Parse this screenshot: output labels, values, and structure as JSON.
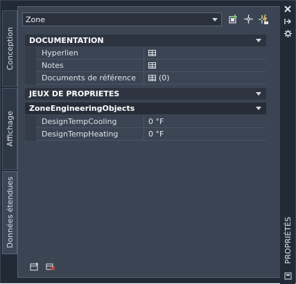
{
  "tabs": [
    {
      "label": "Conception"
    },
    {
      "label": "Affichage"
    },
    {
      "label": "Données étendues"
    }
  ],
  "selector": {
    "value": "Zone"
  },
  "toolbar": {
    "icons": [
      "select-objects-icon",
      "pick-point-icon",
      "quick-select-icon"
    ]
  },
  "sections": {
    "documentation": {
      "title": "DOCUMENTATION",
      "rows": [
        {
          "label": "Hyperlien",
          "value": ""
        },
        {
          "label": "Notes",
          "value": ""
        },
        {
          "label": "Documents de référence",
          "value": "(0)"
        }
      ]
    },
    "property_sets": {
      "title": "JEUX DE PROPRIETES",
      "subsection": {
        "title": "ZoneEngineeringObjects",
        "rows": [
          {
            "label": "DesignTempCooling",
            "value": "0 °F"
          },
          {
            "label": "DesignTempHeating",
            "value": "0 °F"
          }
        ]
      }
    }
  },
  "side": {
    "title": "PROPRIÉTÉS",
    "icons": [
      "close-icon",
      "auto-hide-icon",
      "settings-icon",
      "properties-icon"
    ]
  },
  "bottom_icons": [
    "add-property-set-icon",
    "remove-property-set-icon"
  ]
}
